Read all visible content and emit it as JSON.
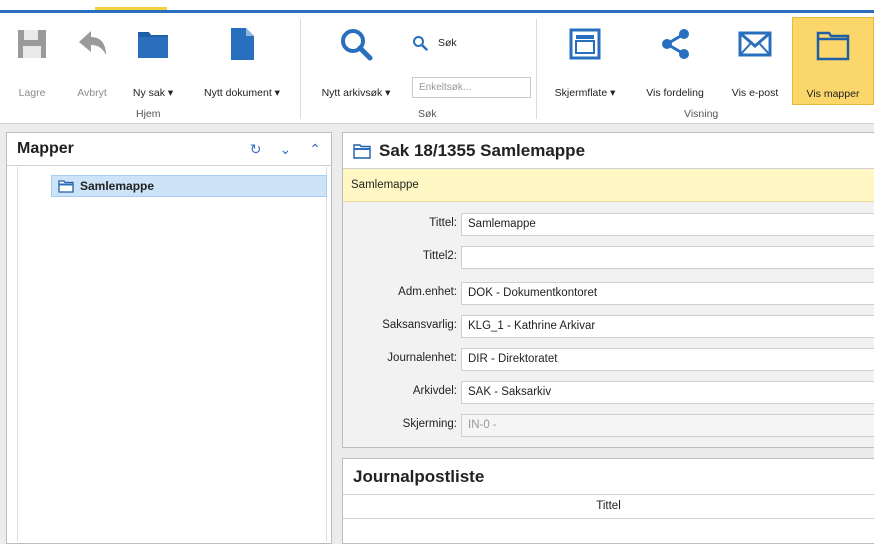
{
  "ribbon": {
    "groups": {
      "home": "Hjem",
      "search": "Søk",
      "view": "Visning"
    },
    "buttons": {
      "save": "Lagre",
      "cancel": "Avbryt",
      "new_case": "Ny sak ▾",
      "new_document": "Nytt dokument ▾",
      "new_archive_search": "Nytt arkivsøk ▾",
      "search_small": "Søk",
      "screen_area": "Skjermflate ▾",
      "show_distribution": "Vis fordeling",
      "show_email": "Vis e-post",
      "show_folders": "Vis mapper"
    },
    "search_placeholder": "Enkeltsøk...",
    "accent_color": "#2a6fbd",
    "active_color": "#fbd66a"
  },
  "folders_panel": {
    "title": "Mapper",
    "items": [
      {
        "label": "Samlemappe",
        "selected": true
      }
    ]
  },
  "case_panel": {
    "title": "Sak 18/1355 Samlemappe",
    "banner": "Samlemappe",
    "fields": [
      {
        "label": "Tittel:",
        "value": "Samlemappe"
      },
      {
        "label": "Tittel2:",
        "value": ""
      },
      {
        "label": "Adm.enhet:",
        "value": "DOK - Dokumentkontoret"
      },
      {
        "label": "Saksansvarlig:",
        "value": "KLG_1 - Kathrine Arkivar"
      },
      {
        "label": "Journalenhet:",
        "value": "DIR - Direktoratet"
      },
      {
        "label": "Arkivdel:",
        "value": "SAK - Saksarkiv"
      },
      {
        "label": "Skjerming:",
        "value": "IN-0 -"
      }
    ]
  },
  "journal_panel": {
    "title": "Journalpostliste",
    "columns": [
      "Tittel"
    ]
  }
}
